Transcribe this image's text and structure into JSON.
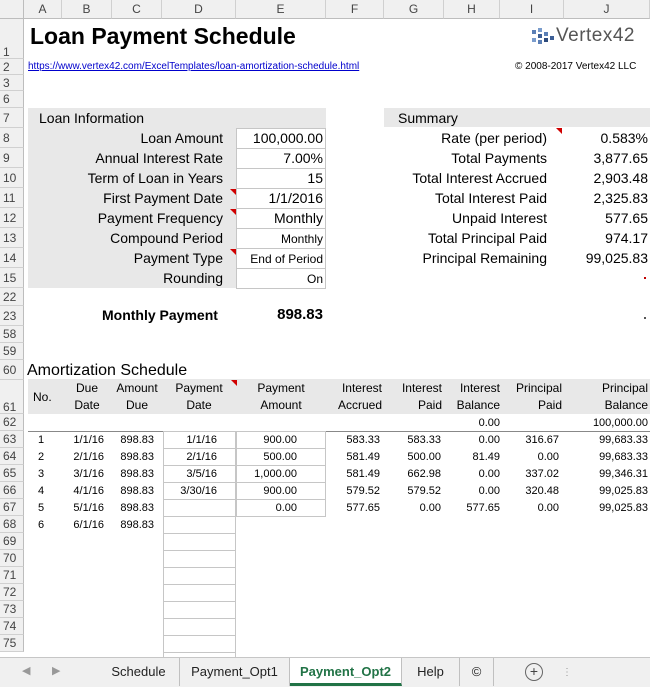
{
  "sheet": {
    "columns": [
      "A",
      "B",
      "C",
      "D",
      "E",
      "F",
      "G",
      "H",
      "I",
      "J"
    ],
    "row_numbers": [
      "1",
      "2",
      "3",
      "6",
      "7",
      "8",
      "9",
      "10",
      "11",
      "12",
      "13",
      "14",
      "15",
      "22",
      "23",
      "58",
      "59",
      "60",
      "61",
      "62",
      "63",
      "64",
      "65",
      "66",
      "67",
      "68",
      "69",
      "70",
      "71",
      "72",
      "73",
      "74",
      "75"
    ]
  },
  "header": {
    "title": "Loan Payment Schedule",
    "logo": "Vertex42",
    "url": "https://www.vertex42.com/ExcelTemplates/loan-amortization-schedule.html",
    "copyright": "© 2008-2017 Vertex42 LLC"
  },
  "loan_info": {
    "heading": "Loan Information",
    "rows": [
      {
        "label": "Loan Amount",
        "value": "100,000.00"
      },
      {
        "label": "Annual Interest Rate",
        "value": "7.00%"
      },
      {
        "label": "Term of Loan in Years",
        "value": "15"
      },
      {
        "label": "First Payment Date",
        "value": "1/1/2016"
      },
      {
        "label": "Payment Frequency",
        "value": "Monthly"
      },
      {
        "label": "Compound Period",
        "value": "Monthly"
      },
      {
        "label": "Payment Type",
        "value": "End of Period"
      },
      {
        "label": "Rounding",
        "value": "On"
      }
    ],
    "monthly_payment_label": "Monthly Payment",
    "monthly_payment_value": "898.83"
  },
  "summary": {
    "heading": "Summary",
    "rows": [
      {
        "label": "Rate (per period)",
        "value": "0.583%"
      },
      {
        "label": "Total Payments",
        "value": "3,877.65"
      },
      {
        "label": "Total Interest Accrued",
        "value": "2,903.48"
      },
      {
        "label": "Total Interest Paid",
        "value": "2,325.83"
      },
      {
        "label": "Unpaid Interest",
        "value": "577.65"
      },
      {
        "label": "Total Principal Paid",
        "value": "974.17"
      },
      {
        "label": "Principal Remaining",
        "value": "99,025.83"
      }
    ]
  },
  "schedule": {
    "heading": "Amortization Schedule",
    "headers": {
      "no": "No.",
      "due_date": [
        "Due",
        "Date"
      ],
      "amount_due": [
        "Amount",
        "Due"
      ],
      "payment_date": [
        "Payment",
        "Date"
      ],
      "payment_amount": [
        "Payment",
        "Amount"
      ],
      "interest_accrued": [
        "Interest",
        "Accrued"
      ],
      "interest_paid": [
        "Interest",
        "Paid"
      ],
      "interest_balance": [
        "Interest",
        "Balance"
      ],
      "principal_paid": [
        "Principal",
        "Paid"
      ],
      "principal_balance": [
        "Principal",
        "Balance"
      ]
    },
    "initial_row": {
      "interest_balance": "0.00",
      "principal_balance": "100,000.00"
    },
    "rows": [
      {
        "no": "1",
        "due": "1/1/16",
        "amt": "898.83",
        "pdate": "1/1/16",
        "pamt": "900.00",
        "iacc": "583.33",
        "ipaid": "583.33",
        "ibal": "0.00",
        "ppaid": "316.67",
        "pbal": "99,683.33"
      },
      {
        "no": "2",
        "due": "2/1/16",
        "amt": "898.83",
        "pdate": "2/1/16",
        "pamt": "500.00",
        "iacc": "581.49",
        "ipaid": "500.00",
        "ibal": "81.49",
        "ppaid": "0.00",
        "pbal": "99,683.33"
      },
      {
        "no": "3",
        "due": "3/1/16",
        "amt": "898.83",
        "pdate": "3/5/16",
        "pamt": "1,000.00",
        "iacc": "581.49",
        "ipaid": "662.98",
        "ibal": "0.00",
        "ppaid": "337.02",
        "pbal": "99,346.31"
      },
      {
        "no": "4",
        "due": "4/1/16",
        "amt": "898.83",
        "pdate": "3/30/16",
        "pamt": "900.00",
        "iacc": "579.52",
        "ipaid": "579.52",
        "ibal": "0.00",
        "ppaid": "320.48",
        "pbal": "99,025.83"
      },
      {
        "no": "5",
        "due": "5/1/16",
        "amt": "898.83",
        "pdate": "",
        "pamt": "0.00",
        "iacc": "577.65",
        "ipaid": "0.00",
        "ibal": "577.65",
        "ppaid": "0.00",
        "pbal": "99,025.83"
      },
      {
        "no": "6",
        "due": "6/1/16",
        "amt": "898.83",
        "pdate": "",
        "pamt": "",
        "iacc": "",
        "ipaid": "",
        "ibal": "",
        "ppaid": "",
        "pbal": ""
      }
    ]
  },
  "tabs": {
    "items": [
      "Schedule",
      "Payment_Opt1",
      "Payment_Opt2",
      "Help",
      "©"
    ],
    "active": "Payment_Opt2",
    "add_label": "+"
  },
  "colors": {
    "accent_green": "#217346",
    "comment_marker": "#d00000",
    "section_gray": "#e8e8e8"
  }
}
